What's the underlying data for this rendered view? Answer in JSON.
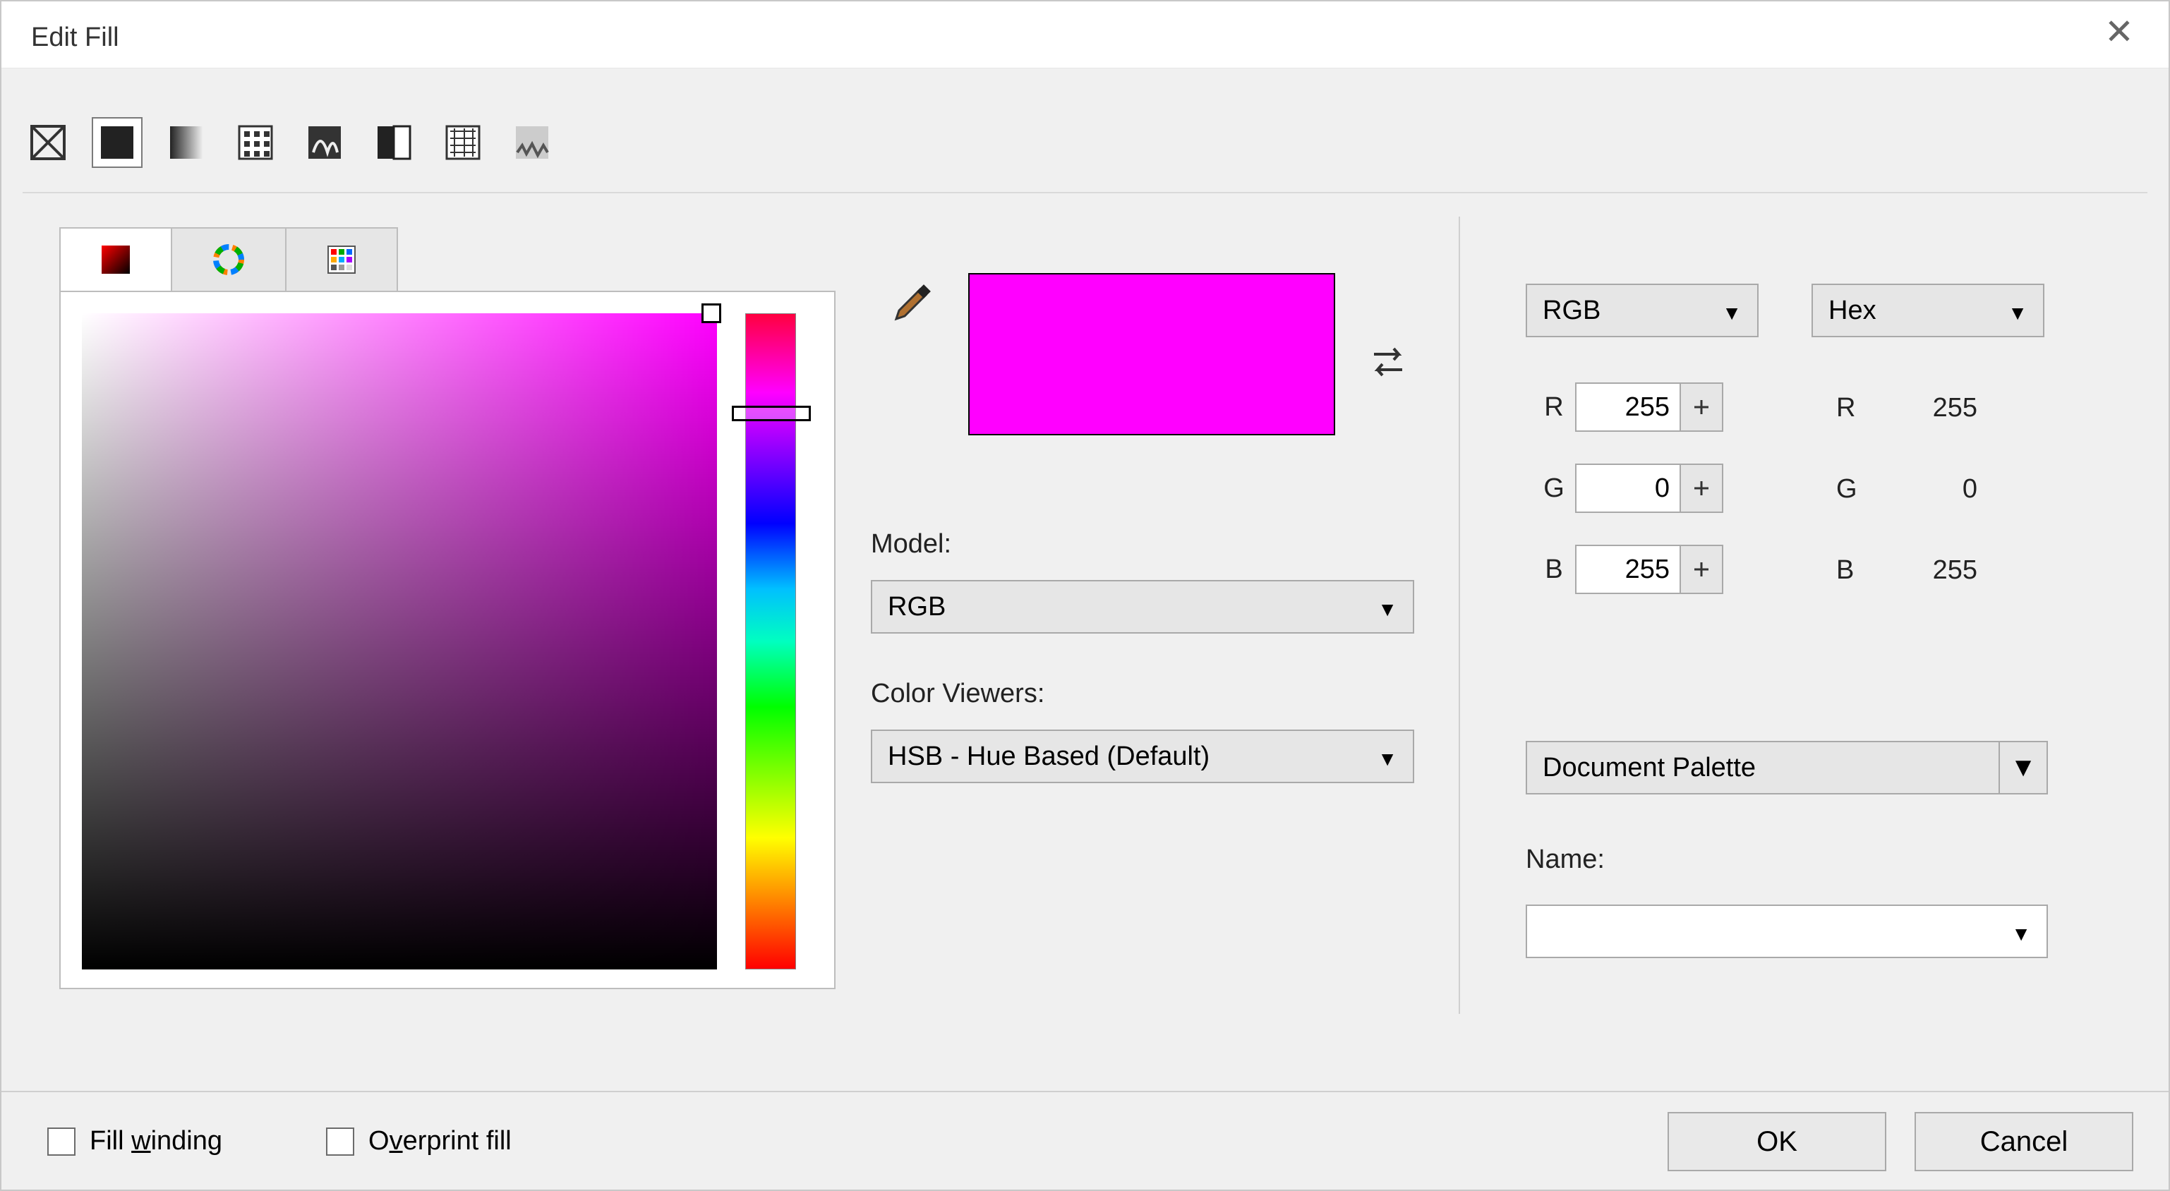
{
  "dialog": {
    "title": "Edit Fill"
  },
  "selectedColor": "#ff00ff",
  "model": {
    "label": "Model:",
    "value": "RGB"
  },
  "colorViewers": {
    "label": "Color Viewers:",
    "value": "HSB - Hue Based (Default)"
  },
  "leftDD": {
    "value": "RGB"
  },
  "rightDD": {
    "value": "Hex"
  },
  "channels": {
    "r": {
      "label": "R",
      "value": "255"
    },
    "g": {
      "label": "G",
      "value": "0"
    },
    "b": {
      "label": "B",
      "value": "255"
    }
  },
  "hex": {
    "r": {
      "label": "R",
      "value": "255"
    },
    "g": {
      "label": "G",
      "value": "0"
    },
    "b": {
      "label": "B",
      "value": "255"
    }
  },
  "palette": {
    "value": "Document Palette"
  },
  "name": {
    "label": "Name:",
    "value": ""
  },
  "footer": {
    "fillWinding": "Fill winding",
    "overprint": "Overprint fill",
    "ok": "OK",
    "cancel": "Cancel"
  }
}
